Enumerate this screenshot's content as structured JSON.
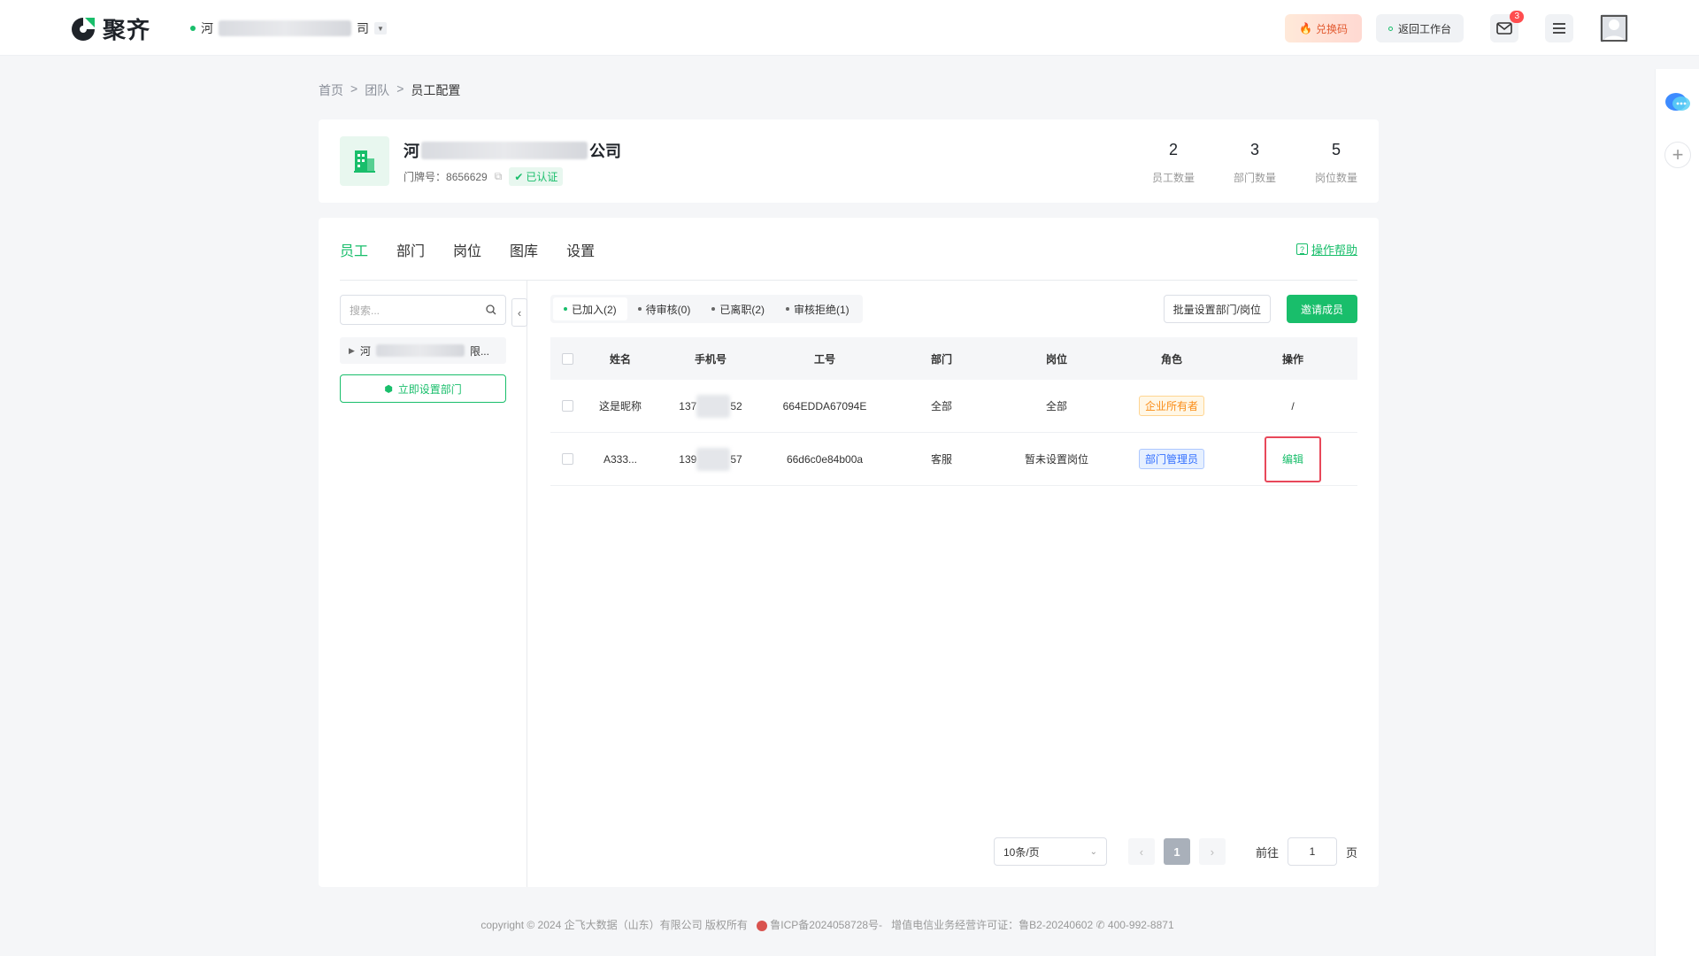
{
  "brand": {
    "name": "聚齐",
    "color": "#19be6b"
  },
  "header": {
    "company_prefix": "河",
    "company_suffix": "司",
    "redeem_label": "兑换码",
    "back_label": "返回工作台",
    "mail_badge": "3"
  },
  "breadcrumb": {
    "items": [
      "首页",
      "团队",
      "员工配置"
    ]
  },
  "company": {
    "name_prefix": "河",
    "name_suffix": "公司",
    "door_no_label": "门牌号：",
    "door_no": "8656629",
    "verified_label": "已认证",
    "stats": [
      {
        "value": "2",
        "label": "员工数量"
      },
      {
        "value": "3",
        "label": "部门数量"
      },
      {
        "value": "5",
        "label": "岗位数量"
      }
    ]
  },
  "tabs": [
    "员工",
    "部门",
    "岗位",
    "图库",
    "设置"
  ],
  "active_tab": "员工",
  "help_label": "操作帮助",
  "left_panel": {
    "search_placeholder": "搜索...",
    "tree_item_prefix": "河",
    "tree_item_suffix": "限...",
    "set_dept_label": "立即设置部门"
  },
  "subtabs": [
    {
      "label": "已加入(2)",
      "active": true
    },
    {
      "label": "待审核(0)",
      "active": false
    },
    {
      "label": "已离职(2)",
      "active": false
    },
    {
      "label": "审核拒绝(1)",
      "active": false
    }
  ],
  "buttons": {
    "batch_label": "批量设置部门/岗位",
    "invite_label": "邀请成员"
  },
  "table": {
    "columns": [
      "姓名",
      "手机号",
      "工号",
      "部门",
      "岗位",
      "角色",
      "操作"
    ],
    "rows": [
      {
        "name": "这是昵称",
        "phone_prefix": "137",
        "phone_suffix": "52",
        "emp_no": "664EDDA67094E",
        "dept": "全部",
        "post": "全部",
        "role": "企业所有者",
        "action": "/"
      },
      {
        "name": "A333...",
        "phone_prefix": "139",
        "phone_suffix": "57",
        "emp_no": "66d6c0e84b00a",
        "dept": "客服",
        "post": "暂未设置岗位",
        "role": "部门管理员",
        "action": "编辑"
      }
    ]
  },
  "pagination": {
    "page_size": "10条/页",
    "current": "1",
    "goto_label": "前往",
    "goto_value": "1",
    "page_unit": "页"
  },
  "footer": {
    "text": "copyright © 2024 企飞大数据（山东）有限公司 版权所有",
    "icp": "鲁ICP备2024058728号-",
    "license": "增值电信业务经营许可证：鲁B2-20240602",
    "phone": "400-992-8871"
  }
}
